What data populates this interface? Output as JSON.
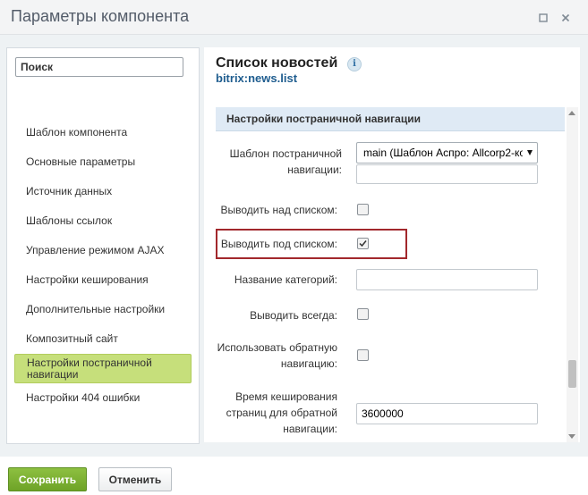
{
  "window": {
    "title": "Параметры компонента",
    "maximize_icon": "maximize-icon",
    "close_icon": "close-icon"
  },
  "sidebar": {
    "search": {
      "placeholder": "Поиск",
      "value": ""
    },
    "items": [
      {
        "label": "Шаблон компонента",
        "active": false
      },
      {
        "label": "Основные параметры",
        "active": false
      },
      {
        "label": "Источник данных",
        "active": false
      },
      {
        "label": "Шаблоны ссылок",
        "active": false
      },
      {
        "label": "Управление режимом AJAX",
        "active": false
      },
      {
        "label": "Настройки кеширования",
        "active": false
      },
      {
        "label": "Дополнительные настройки",
        "active": false
      },
      {
        "label": "Композитный сайт",
        "active": false
      },
      {
        "label": "Настройки постраничной навигации",
        "active": true
      },
      {
        "label": "Настройки 404 ошибки",
        "active": false
      }
    ]
  },
  "component": {
    "title": "Список новостей",
    "info_glyph": "i",
    "code": "bitrix:news.list"
  },
  "section": {
    "title": "Настройки постраничной навигации",
    "fields": {
      "pager_template": {
        "label": "Шаблон постраничной навигации:",
        "value": "main (Шаблон Аспро: Allcorp2-ко",
        "extra_value": ""
      },
      "display_top": {
        "label": "Выводить над списком:",
        "checked": false
      },
      "display_bottom": {
        "label": "Выводить под списком:",
        "checked": true
      },
      "pager_title": {
        "label": "Название категорий:",
        "value": ""
      },
      "show_always": {
        "label": "Выводить всегда:",
        "checked": false
      },
      "desc_numbering": {
        "label": "Использовать обратную навигацию:",
        "checked": false
      },
      "desc_cache_time": {
        "label": "Время кеширования страниц для обратной навигации:",
        "value": "3600000"
      }
    }
  },
  "footer": {
    "save_label": "Сохранить",
    "cancel_label": "Отменить"
  },
  "colors": {
    "save_button": "#7bb131",
    "active_nav": "#c6df7b",
    "section_header": "#dfeaf5",
    "highlight": "#a2282c",
    "link_blue": "#1f5d8f"
  }
}
